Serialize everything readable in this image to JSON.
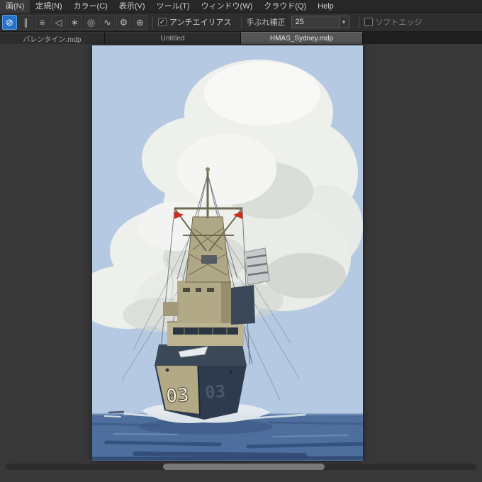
{
  "menu_bar": {
    "items": [
      "画(N)",
      "定規(N)",
      "カラー(C)",
      "表示(V)",
      "ツール(T)",
      "ウィンドウ(W)",
      "クラウド(Q)",
      "Help"
    ]
  },
  "toolbar": {
    "icons": [
      {
        "name": "no-snap",
        "glyph": "⊘"
      },
      {
        "name": "parallel-snap",
        "glyph": "∥"
      },
      {
        "name": "horizontal-snap",
        "glyph": "≡"
      },
      {
        "name": "vanishing-point-snap",
        "glyph": "◁"
      },
      {
        "name": "radial-snap",
        "glyph": "∗"
      },
      {
        "name": "circle-snap",
        "glyph": "◎"
      },
      {
        "name": "curve-snap",
        "glyph": "∿"
      },
      {
        "name": "snap-settings",
        "glyph": "⚙"
      },
      {
        "name": "snap-add",
        "glyph": "⊕"
      }
    ],
    "antialias": {
      "label": "アンチエイリアス",
      "checked": true
    },
    "stabilizer": {
      "label": "手ぶれ補正",
      "value": "25"
    },
    "soft_edge": {
      "label": "ソフトエッジ",
      "checked": false
    }
  },
  "tab_bar": {
    "tabs": [
      {
        "label": "バレンタイン.mdp",
        "active": false
      },
      {
        "label": "Untitled",
        "active": false
      },
      {
        "label": "HMAS_Sydney.mdp",
        "active": true
      }
    ]
  },
  "canvas": {
    "hull_number": "03"
  },
  "ui_glyphs": {
    "check": "✓",
    "caret_down": "▾"
  },
  "colors": {
    "accent_blue": "#2a72c8",
    "sky": "#b5c9e2",
    "sea": "#4e6e9d",
    "cloud": "#eef0ec",
    "ship_hull_navy": "#2e3b4e",
    "ship_superstructure_tan": "#b2a987",
    "flag_red": "#cf2a1a"
  }
}
